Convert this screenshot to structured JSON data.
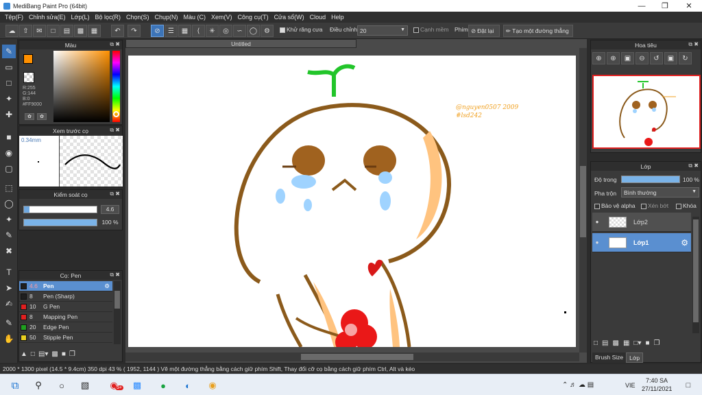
{
  "window": {
    "title": "MediBang Paint Pro (64bit)"
  },
  "menu": [
    "Tệp(F)",
    "Chỉnh sửa(E)",
    "Lớp(L)",
    "Bộ lọc(R)",
    "Chọn(S)",
    "Chụp(N)",
    "Màu (C)",
    "Xem(V)",
    "Công cụ(T)",
    "Cửa sổ(W)",
    "Cloud",
    "Help"
  ],
  "toolbar": {
    "antialias_label": "Khử răng cưa",
    "adjust_label": "Điều chỉnh",
    "adjust_value": "20",
    "smooth_label": "Cạnh mềm",
    "key_label": "Phím",
    "reset_label": "Đặt lại",
    "line_label": "Tạo một đường thẳng"
  },
  "color_panel": {
    "title": "Màu",
    "r": "R:255",
    "g": "G:144",
    "b": "B:0",
    "hex": "#FF9000",
    "primary_color": "#ff9000"
  },
  "preview_panel": {
    "title": "Xem trước cọ",
    "size_label": "0.34mm"
  },
  "brush_control": {
    "title": "Kiểm soát cọ",
    "size": "4.6",
    "opacity": "100 %"
  },
  "brush_panel": {
    "title": "Cọ: Pen",
    "items": [
      {
        "size": "4.6",
        "name": "Pen",
        "color": "#1f1f1f"
      },
      {
        "size": "8",
        "name": "Pen (Sharp)",
        "color": "#1f1f1f"
      },
      {
        "size": "10",
        "name": "G Pen",
        "color": "#e02020"
      },
      {
        "size": "8",
        "name": "Mapping Pen",
        "color": "#e02020"
      },
      {
        "size": "20",
        "name": "Edge Pen",
        "color": "#20a020"
      },
      {
        "size": "50",
        "name": "Stipple Pen",
        "color": "#e8d020"
      }
    ]
  },
  "document": {
    "tab": "Untitled",
    "signature_line1": "@nguyen0507 2009",
    "signature_line2": "#lsd242"
  },
  "navigator": {
    "title": "Hoa tiêu"
  },
  "layer_panel": {
    "title": "Lớp",
    "opacity_label": "Độ trong",
    "opacity_value": "100 %",
    "blend_label": "Pha trộn",
    "blend_value": "Bình thường",
    "protect_alpha": "Bảo vệ alpha",
    "clipping": "Xén bớt",
    "lock": "Khóa",
    "layers": [
      {
        "name": "Lớp2",
        "selected": false
      },
      {
        "name": "Lớp1",
        "selected": true
      }
    ],
    "tabs": [
      "Brush Size",
      "Lớp"
    ]
  },
  "status": {
    "dimensions": "2000 * 1300 pixel",
    "cm": "(14.5 * 9.4cm)",
    "dpi": "350 dpi",
    "zoom": "43 %",
    "coords": "( 1952, 1144 )",
    "hint": "Vẽ một đường thẳng bằng cách giữ phím Shift, Thay đổi cỡ cọ bằng cách giữ phím Ctrl, Alt và kéo"
  },
  "taskbar": {
    "lang": "VIE",
    "time": "7:40 SA",
    "date": "27/11/2021",
    "notif": "5+"
  }
}
